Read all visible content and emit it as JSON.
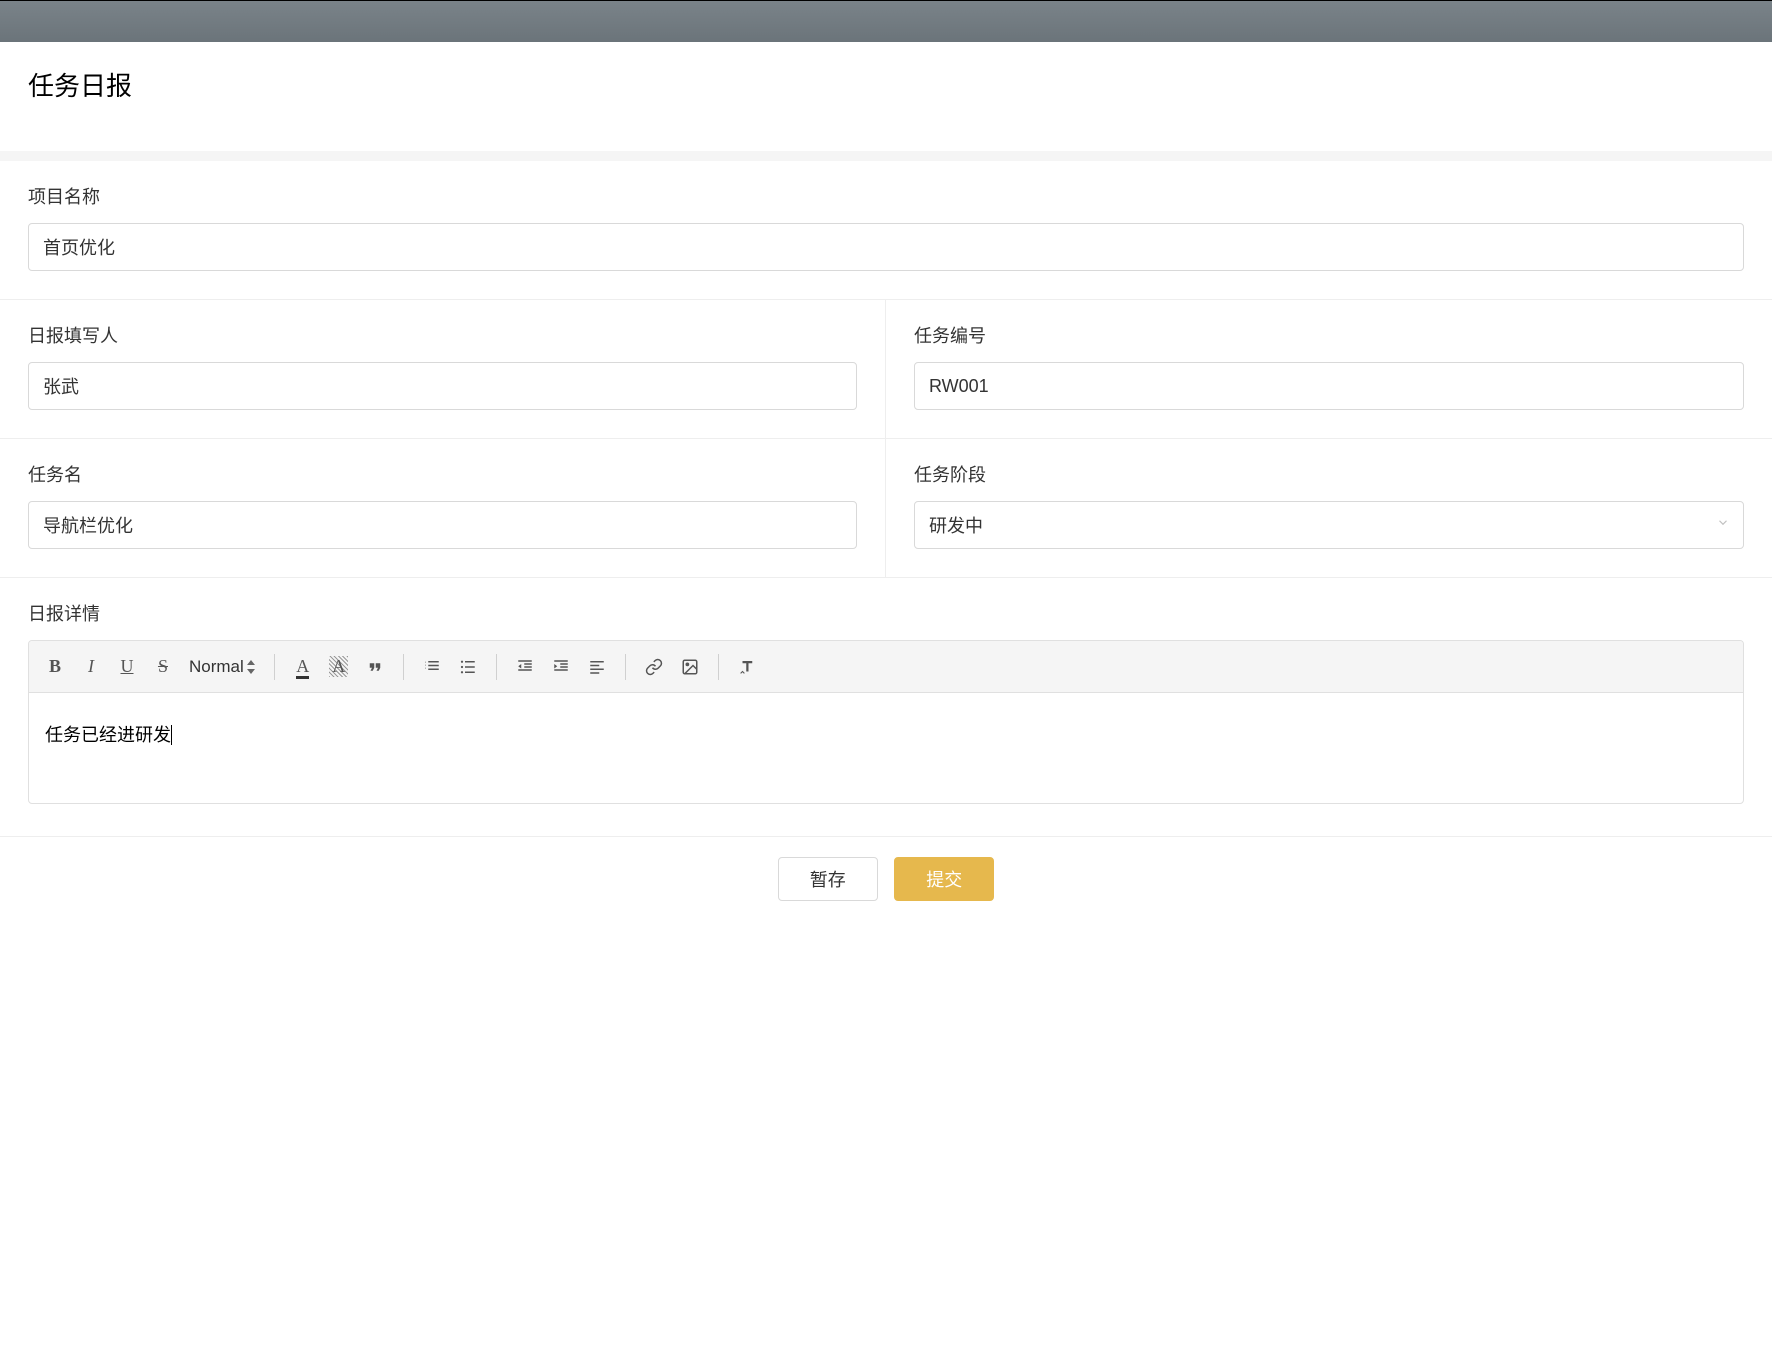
{
  "page": {
    "title": "任务日报"
  },
  "fields": {
    "project_name": {
      "label": "项目名称",
      "value": "首页优化"
    },
    "reporter": {
      "label": "日报填写人",
      "value": "张武"
    },
    "task_no": {
      "label": "任务编号",
      "value": "RW001"
    },
    "task_name": {
      "label": "任务名",
      "value": "导航栏优化"
    },
    "task_stage": {
      "label": "任务阶段",
      "value": "研发中"
    },
    "details": {
      "label": "日报详情",
      "value": "任务已经进研发"
    }
  },
  "toolbar": {
    "format_label": "Normal"
  },
  "buttons": {
    "save_draft": "暂存",
    "submit": "提交"
  }
}
